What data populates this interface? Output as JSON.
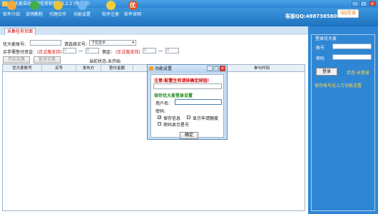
{
  "window": {
    "title": "优大麦自动采集任务软件 V5.2.1 (免费版)"
  },
  "toolbar": {
    "items": [
      {
        "label": "软件介绍",
        "color": "#f2a93b"
      },
      {
        "label": "说明教程",
        "color": "#3fae49"
      },
      {
        "label": "代理合作",
        "color": "#e8c13a"
      },
      {
        "label": "功能设置",
        "color": "#6fb6f0"
      },
      {
        "label": "软件注册",
        "color": "#f0cf3a"
      },
      {
        "label": "软件官网",
        "color": "#e2541f"
      }
    ],
    "service": "客服QQ:488738580",
    "qq_button": "QQ交谈",
    "logo_char": "优"
  },
  "tabs": {
    "active": "采集任务页面"
  },
  "form": {
    "account_label": "优大麦账号:",
    "buyer_label": "请选择买号:",
    "buyer_select": "下拉显示",
    "advance_label": "买手需垫付资金:",
    "official_support": "(正式版支持)",
    "min1": "0",
    "dash": "—",
    "max1": "0",
    "commission_label": "佣金:",
    "min2": "0",
    "max2": "0",
    "start_button": "开始采集",
    "pause_button": "暂停采集",
    "status": "当前状态:未开始"
  },
  "table": {
    "columns": [
      "优大麦账号",
      "买号",
      "发布方",
      "垫付金额",
      "佣金",
      "参与时间"
    ]
  },
  "sidebar": {
    "title": "登录优大麦",
    "account_label": "账号",
    "password_label": "密码",
    "login_button": "登录",
    "status": "状态:未登录",
    "note": "保存账号见上方功能设置"
  },
  "dialog": {
    "title": "功能设置",
    "min_label": "_",
    "max_label": "□",
    "close_label": "×",
    "warning": "注意:配置生效请按确定按钮!",
    "section": "保存优大麦登录设置",
    "username_label": "用户名:",
    "password_label": "密码:",
    "save_info": "保存信息",
    "show_apply": "显示申请额度",
    "show_password": "密码显示星号",
    "ok_button": "确定"
  }
}
